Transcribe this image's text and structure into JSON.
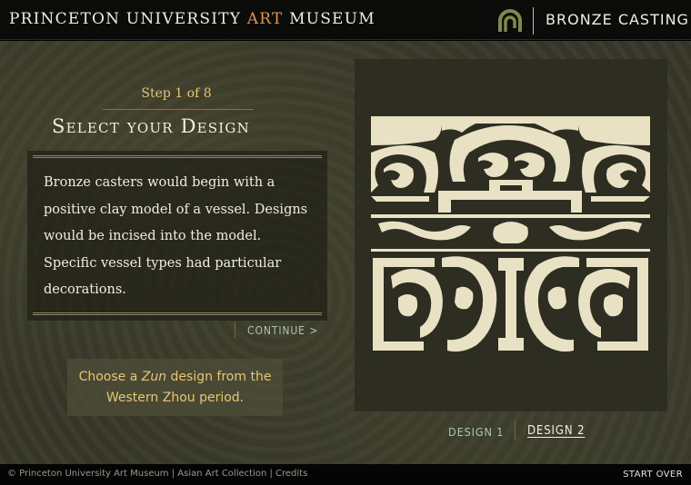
{
  "header": {
    "brand_part1": "PRINCETON UNIVERSITY",
    "brand_accent": "ART",
    "brand_part2": "MUSEUM",
    "logo_icon": "spiral-logo-icon",
    "section_title": "BRONZE CASTING"
  },
  "main": {
    "step_label": "Step 1 of 8",
    "title": "Select your Design",
    "description": "Bronze casters would begin with a positive clay model of a vessel. Designs would be incised into the model.  Specific vessel types had particular decorations.",
    "continue_label": "CONTINUE >",
    "hint_prefix": "Choose a ",
    "hint_italic": "Zun",
    "hint_suffix": " design from the Western Zhou period."
  },
  "design_tabs": {
    "design1_label": "DESIGN 1",
    "design2_label": "DESIGN 2",
    "selected": "DESIGN 2"
  },
  "footer": {
    "copyright": "© Princeton University Art Museum",
    "separator": " | ",
    "collection": "Asian Art Collection",
    "credits": "Credits",
    "start_over": "START OVER"
  },
  "colors": {
    "accent_orange": "#e0944c",
    "gold_text": "#e6c670",
    "link_green": "#a9c6b0",
    "design_cream": "#e9e1c4"
  }
}
